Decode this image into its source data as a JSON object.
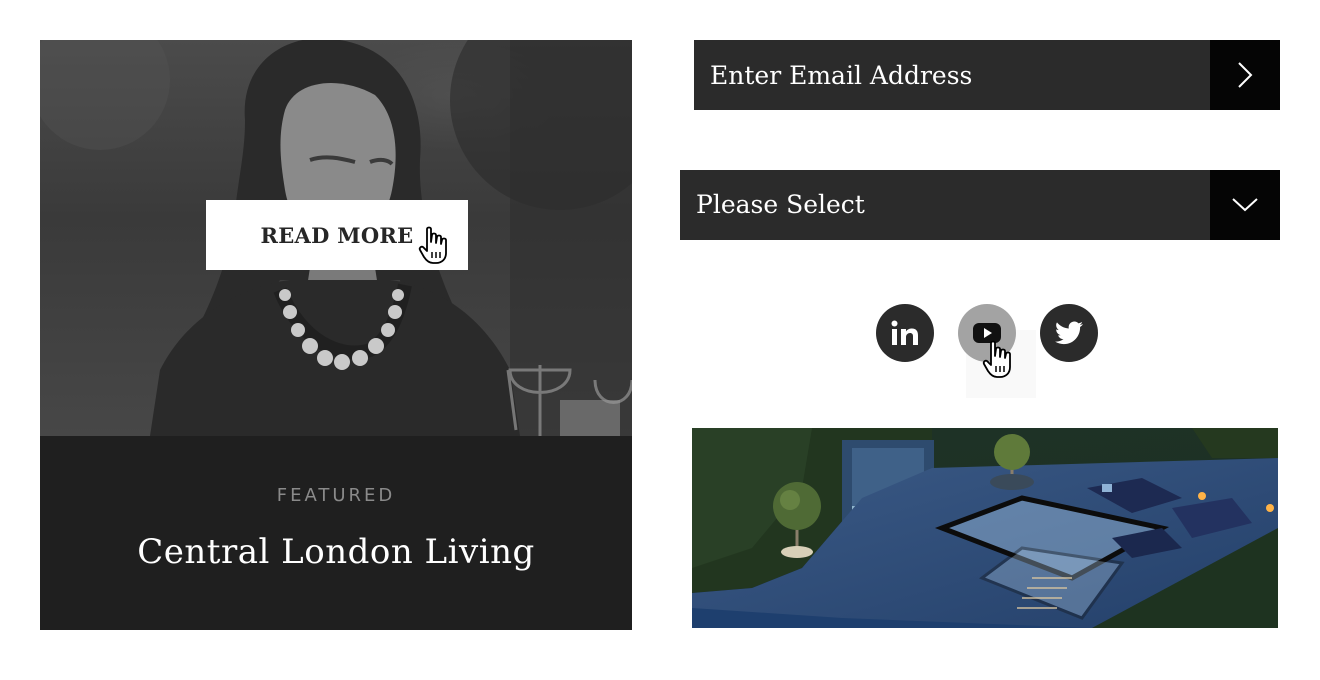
{
  "featured_card": {
    "button_label": "READ MORE",
    "label": "FEATURED",
    "title": "Central London Living",
    "image_icon": "woman-portrait-photo"
  },
  "newsletter": {
    "email_placeholder": "Enter Email Address",
    "submit_icon": "chevron-right-icon"
  },
  "dropdown": {
    "selected": "Please Select",
    "toggle_icon": "chevron-down-icon"
  },
  "social": {
    "items": [
      {
        "name": "linkedin",
        "icon": "linkedin-icon",
        "state": "default"
      },
      {
        "name": "youtube",
        "icon": "youtube-icon",
        "state": "hover"
      },
      {
        "name": "twitter",
        "icon": "twitter-icon",
        "state": "default"
      }
    ],
    "colors": {
      "default": "#2b2b2b",
      "hover": "#a3a3a3"
    }
  },
  "promo_image": {
    "icon": "rooftop-garden-photo"
  },
  "colors": {
    "field_bg": "#2b2b2b",
    "button_bg": "#050505",
    "card_bg": "#1f1f1f"
  }
}
